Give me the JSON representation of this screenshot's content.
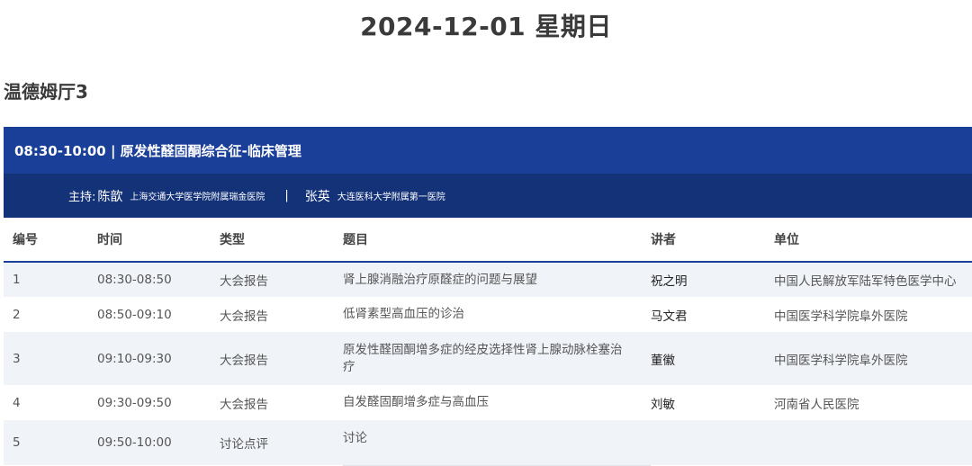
{
  "page": {
    "date_title": "2024-12-01 星期日",
    "hall": "温德姆厅3"
  },
  "colors": {
    "session_header": "#1a3f99",
    "chair_bar": "#143278",
    "row_alt": "#f0f3f8"
  },
  "session": {
    "title": "08:30-10:00 | 原发性醛固酮综合征-临床管理",
    "chair_label": "主持:",
    "chairs": [
      {
        "name": "陈歆",
        "institution": "上海交通大学医学院附属瑞金医院"
      },
      {
        "name": "张英",
        "institution": "大连医科大学附属第一医院"
      }
    ],
    "chair_separator": "|"
  },
  "table": {
    "headers": [
      "编号",
      "时间",
      "类型",
      "题目",
      "讲者",
      "单位"
    ],
    "rows": [
      {
        "no": "1",
        "time": "08:30-08:50",
        "type": "大会报告",
        "topic": "肾上腺消融治疗原醛症的问题与展望",
        "speaker": "祝之明",
        "unit": "中国人民解放军陆军特色医学中心"
      },
      {
        "no": "2",
        "time": "08:50-09:10",
        "type": "大会报告",
        "topic": "低肾素型高血压的诊治",
        "speaker": "马文君",
        "unit": "中国医学科学院阜外医院"
      },
      {
        "no": "3",
        "time": "09:10-09:30",
        "type": "大会报告",
        "topic": "原发性醛固酮增多症的经皮选择性肾上腺动脉栓塞治疗",
        "speaker": "董徽",
        "unit": "中国医学科学院阜外医院"
      },
      {
        "no": "4",
        "time": "09:30-09:50",
        "type": "大会报告",
        "topic": "自发醛固酮增多症与高血压",
        "speaker": "刘敏",
        "unit": "河南省人民医院"
      },
      {
        "no": "5",
        "time": "09:50-10:00",
        "type": "讨论点评",
        "topic": "讨论",
        "speaker": "",
        "unit": ""
      }
    ]
  }
}
